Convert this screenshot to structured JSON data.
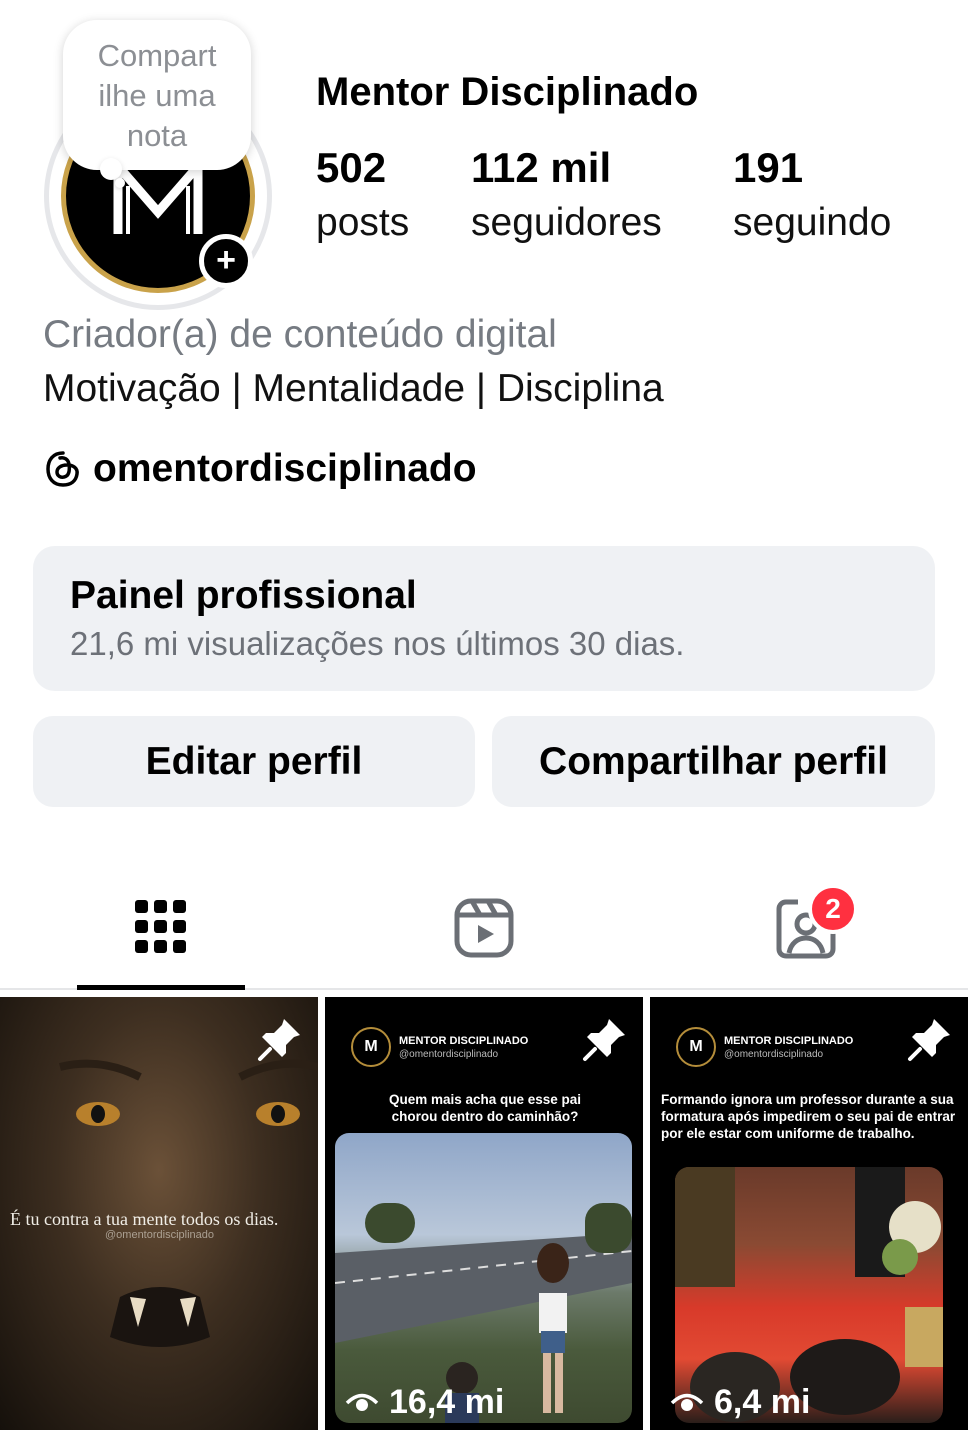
{
  "profile": {
    "name": "Mentor Disciplinado",
    "note_prompt": "Compartilhe uma nota",
    "note_line1": "Compart",
    "note_line2": "ilhe uma",
    "note_line3": "nota",
    "category": "Criador(a) de conteúdo digital",
    "bio": "Motivação | Mentalidade | Disciplina",
    "threads_handle": "omentordisciplinado",
    "avatar_letter": "M"
  },
  "stats": [
    {
      "value": "502",
      "label": "posts"
    },
    {
      "value": "112 mil",
      "label": "seguidores"
    },
    {
      "value": "191",
      "label": "seguindo"
    }
  ],
  "professional_panel": {
    "title": "Painel profissional",
    "subtitle": "21,6 mi visualizações nos últimos 30 dias."
  },
  "buttons": {
    "edit": "Editar perfil",
    "share": "Compartilhar perfil"
  },
  "tabs": {
    "tagged_badge": "2",
    "icons": [
      "grid-icon",
      "reels-icon",
      "tagged-icon"
    ]
  },
  "posts": [
    {
      "quote": "É tu contra a tua mente todos os dias.",
      "watermark": "@omentordisciplinado",
      "pinned": true
    },
    {
      "brand": "MENTOR DISCIPLINADO",
      "handle": "@omentordisciplinado",
      "caption": "Quem mais acha que esse pai chorou dentro do caminhão?",
      "views": "16,4 mi",
      "pinned": true
    },
    {
      "brand": "MENTOR DISCIPLINADO",
      "handle": "@omentordisciplinado",
      "caption": "Formando ignora um professor durante a sua formatura após impedirem o seu pai de entrar por ele estar com uniforme de trabalho.",
      "views": "6,4 mi",
      "pinned": true
    }
  ],
  "colors": {
    "badge_red": "#ff3040",
    "panel_bg": "#eff1f4",
    "avatar_gold": "#c9a24a"
  }
}
